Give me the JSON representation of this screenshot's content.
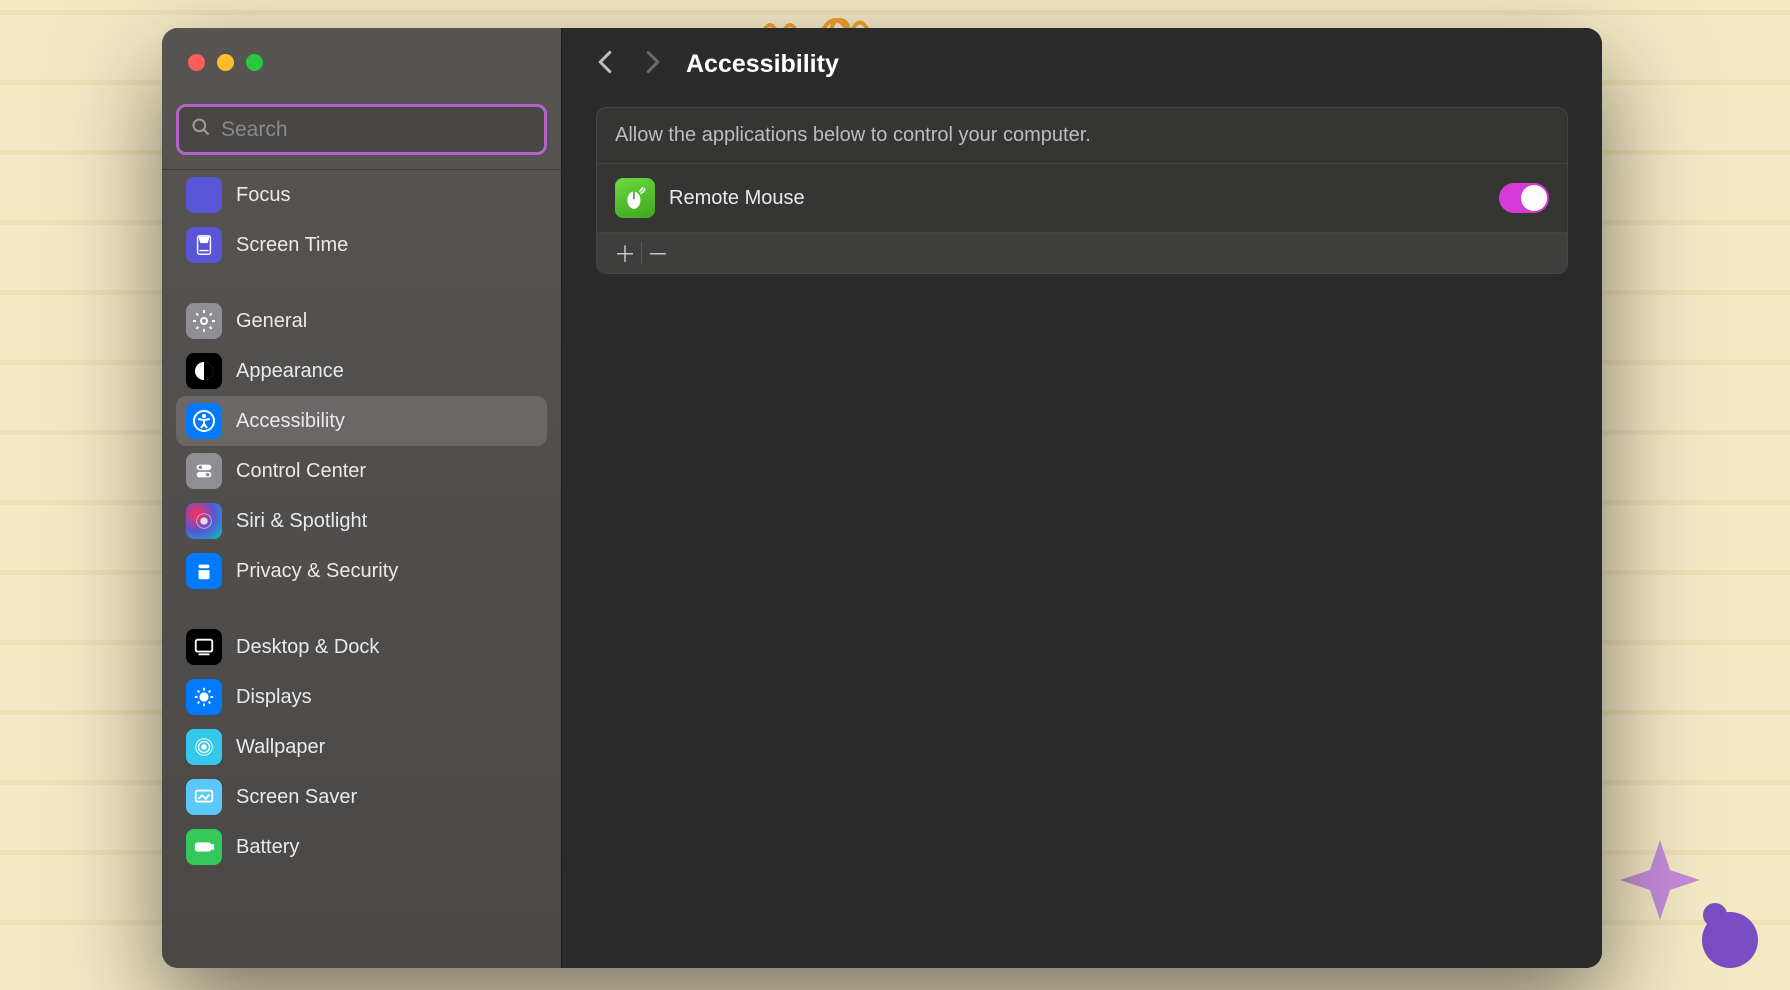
{
  "search": {
    "placeholder": "Search",
    "value": ""
  },
  "sidebar": {
    "group0": [
      {
        "label": "Focus",
        "icon": "focus-icon",
        "selected": false
      },
      {
        "label": "Screen Time",
        "icon": "screentime-icon",
        "selected": false
      }
    ],
    "group1": [
      {
        "label": "General",
        "icon": "general-icon",
        "selected": false
      },
      {
        "label": "Appearance",
        "icon": "appearance-icon",
        "selected": false
      },
      {
        "label": "Accessibility",
        "icon": "accessibility-icon",
        "selected": true
      },
      {
        "label": "Control Center",
        "icon": "controlcenter-icon",
        "selected": false
      },
      {
        "label": "Siri & Spotlight",
        "icon": "siri-icon",
        "selected": false
      },
      {
        "label": "Privacy & Security",
        "icon": "privacy-icon",
        "selected": false
      }
    ],
    "group2": [
      {
        "label": "Desktop & Dock",
        "icon": "desktop-icon",
        "selected": false
      },
      {
        "label": "Displays",
        "icon": "displays-icon",
        "selected": false
      },
      {
        "label": "Wallpaper",
        "icon": "wallpaper-icon",
        "selected": false
      },
      {
        "label": "Screen Saver",
        "icon": "screensaver-icon",
        "selected": false
      },
      {
        "label": "Battery",
        "icon": "battery-icon",
        "selected": false
      }
    ]
  },
  "main": {
    "title": "Accessibility",
    "panel": {
      "description": "Allow the applications below to control your computer.",
      "apps": [
        {
          "name": "Remote Mouse",
          "enabled": true
        }
      ]
    }
  }
}
